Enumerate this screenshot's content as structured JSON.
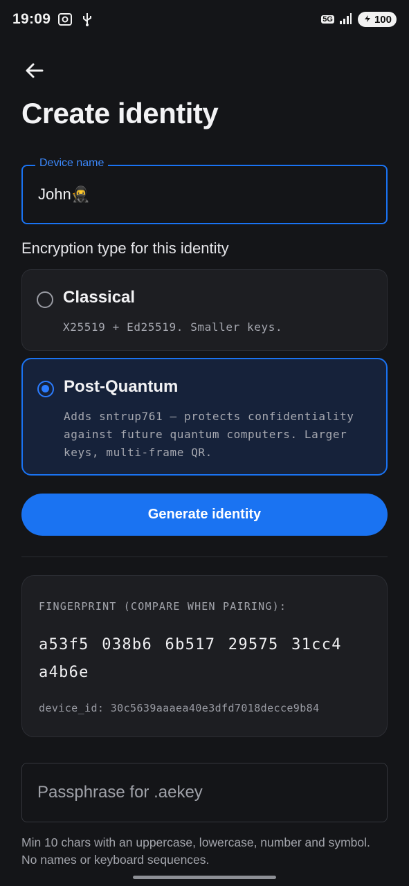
{
  "status_bar": {
    "time": "19:09",
    "network": "5G",
    "battery": "100",
    "icons": [
      "screenshot-icon",
      "usb-icon",
      "signal-icon",
      "battery-icon"
    ]
  },
  "header": {
    "back_icon": "arrow-left-icon",
    "title": "Create identity"
  },
  "device_name_field": {
    "label": "Device name",
    "value": "John🥷"
  },
  "encryption": {
    "section_label": "Encryption type for this identity",
    "options": [
      {
        "title": "Classical",
        "description": "X25519 + Ed25519. Smaller keys.",
        "selected": false
      },
      {
        "title": "Post-Quantum",
        "description": "Adds sntrup761 — protects confidentiality against future quantum computers. Larger keys, multi-frame QR.",
        "selected": true
      }
    ]
  },
  "generate_button": {
    "label": "Generate identity"
  },
  "fingerprint": {
    "label": "FINGERPRINT (COMPARE WHEN PAIRING):",
    "value": "a53f5 038b6 6b517 29575 31cc4 a4b6e",
    "device_id": "device_id: 30c5639aaaea40e3dfd7018decce9b84"
  },
  "passphrase": {
    "placeholder": "Passphrase for .aekey",
    "helper": "Min 10 chars with an uppercase, lowercase, number and symbol. No names or keyboard sequences."
  },
  "colors": {
    "background": "#141518",
    "accent": "#1a73f2",
    "card": "#1d1e22",
    "selected_card": "#16223a"
  }
}
